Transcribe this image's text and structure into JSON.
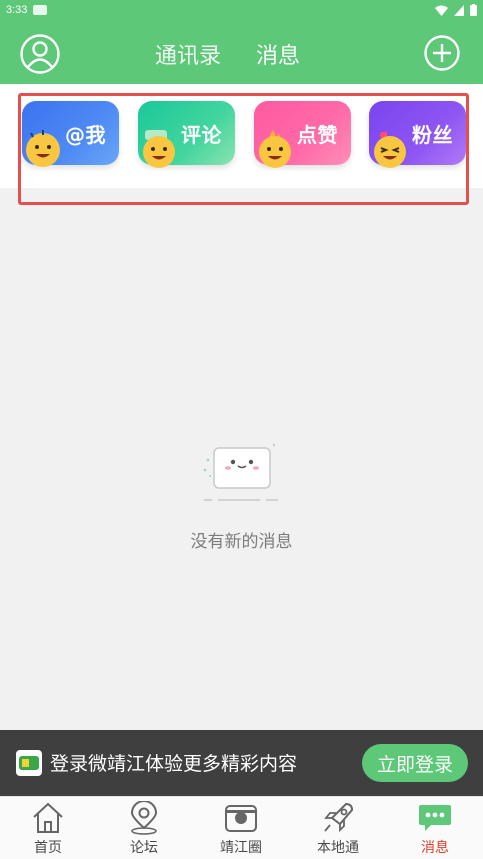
{
  "status_bar": {
    "time": "3:33"
  },
  "header": {
    "tabs": [
      {
        "label": "通讯录"
      },
      {
        "label": "消息"
      }
    ]
  },
  "categories": [
    {
      "label": "@我",
      "color": "#4a86f2"
    },
    {
      "label": "评论",
      "color": "#2fcf9c"
    },
    {
      "label": "点赞",
      "color": "#ff63a4"
    },
    {
      "label": "粉丝",
      "color": "#8950f2"
    }
  ],
  "empty_state": {
    "text": "没有新的消息"
  },
  "login_banner": {
    "text": "登录微靖江体验更多精彩内容",
    "button": "立即登录"
  },
  "bottom_nav": [
    {
      "label": "首页",
      "icon": "home-icon"
    },
    {
      "label": "论坛",
      "icon": "location-pin-icon"
    },
    {
      "label": "靖江圈",
      "icon": "camera-icon"
    },
    {
      "label": "本地通",
      "icon": "rocket-icon"
    },
    {
      "label": "消息",
      "icon": "chat-bubble-icon",
      "active": true
    }
  ],
  "colors": {
    "brand_green": "#5cc878",
    "highlight_red": "#e5504f",
    "active_nav": "#e0402f"
  }
}
